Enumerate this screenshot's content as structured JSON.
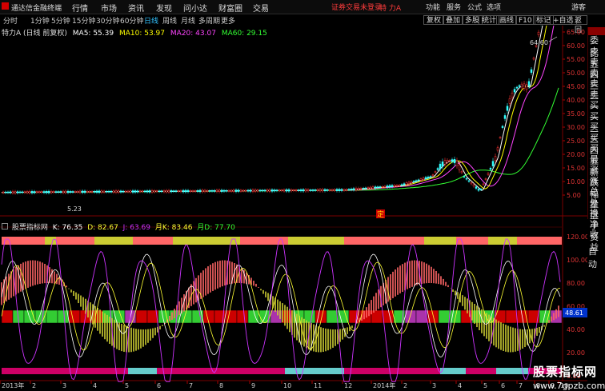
{
  "titlebar": {
    "app_name": "通达信金融终端",
    "menus": [
      "行情",
      "市场",
      "资讯",
      "发现",
      "问小达",
      "财富圈",
      "交易"
    ],
    "warning": "证券交易未登录",
    "stock_title": "特 力A",
    "right_items": [
      "功能",
      "服务",
      "公式",
      "选项",
      "游客"
    ]
  },
  "periodbar": {
    "periods": [
      "分时",
      "1分钟",
      "5分钟",
      "15分钟",
      "30分钟",
      "60分钟",
      "日线",
      "周线",
      "月线",
      "多周期",
      "更多"
    ],
    "active_period": "日线",
    "tools": [
      "复权",
      "叠加",
      "多股",
      "统计",
      "画线",
      "F10",
      "标记",
      "+自选",
      "返回"
    ]
  },
  "price_legend": {
    "title": "特力A (日线 前复权)",
    "ma5": "MA5: 55.39",
    "ma10": "MA10: 53.97",
    "ma20": "MA20: 43.07",
    "ma60": "MA60: 29.15",
    "colors": {
      "ma5": "#ffffff",
      "ma10": "#ffff00",
      "ma20": "#ff44ff",
      "ma60": "#33ff33"
    }
  },
  "price_axis": {
    "ticks": [
      "65.00",
      "60.00",
      "55.00",
      "50.00",
      "45.00",
      "40.00",
      "35.00",
      "30.00",
      "25.00",
      "20.00",
      "15.00",
      "10.00",
      "5.00"
    ]
  },
  "annotations": {
    "high_label": "64.60",
    "low_label": "5.23",
    "event_marker": "定"
  },
  "quote_panel": {
    "rows": [
      "委比",
      "卖五",
      "卖四",
      "卖三",
      "卖二",
      "卖一",
      "买一",
      "买二",
      "买三",
      "买四",
      "买五",
      "最新",
      "涨跌",
      "涨幅",
      "总量",
      "外盘",
      "换手",
      "净资",
      "收益"
    ],
    "auto_label": "自动"
  },
  "indicator_legend": {
    "name": "股票指标网",
    "k": "K: 76.35",
    "d": "D: 82.67",
    "j": "J: 63.69",
    "monthly_k": "月K: 83.46",
    "monthly_d": "月D: 77.70"
  },
  "indicator_axis": {
    "ticks": [
      "120.00",
      "100.00",
      "80.00",
      "60.00",
      "40.00",
      "20.00",
      "0.00"
    ],
    "current_value": "48.61"
  },
  "date_axis": {
    "labels": [
      "2013年",
      "2",
      "3",
      "4",
      "5",
      "6",
      "7",
      "8",
      "9",
      "10",
      "11",
      "12",
      "2014年",
      "2",
      "3",
      "4",
      "5",
      "6",
      "7",
      "8",
      "9",
      "10"
    ]
  },
  "watermark": {
    "title": "股票指标网",
    "url": "www.7gpzb.com"
  }
}
